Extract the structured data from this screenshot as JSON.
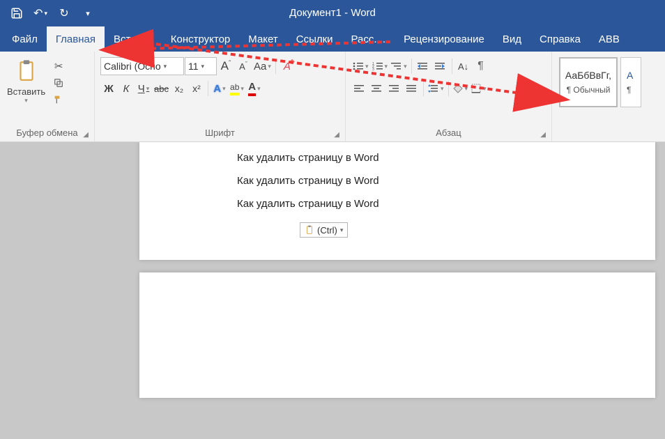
{
  "title": "Документ1  -  Word",
  "tabs": {
    "file": "Файл",
    "home": "Главная",
    "insert": "Вставка",
    "design": "Конструктор",
    "layout": "Макет",
    "references": "Ссылки",
    "mailings": "Расс....",
    "review": "Рецензирование",
    "view": "Вид",
    "help": "Справка",
    "abb": "ABB"
  },
  "clipboard": {
    "paste": "Вставить",
    "group_label": "Буфер обмена"
  },
  "font": {
    "name": "Calibri (Осно",
    "size": "11",
    "bold": "Ж",
    "italic": "К",
    "underline": "Ч",
    "strike": "abc",
    "sub": "x₂",
    "sup": "x²",
    "aa": "Aa",
    "grow": "A",
    "shrink": "A",
    "effects": "A",
    "highlight_glyph": "ab",
    "color_glyph": "A",
    "clear": "A",
    "group_label": "Шрифт"
  },
  "para": {
    "group_label": "Абзац",
    "sort": "А↓",
    "pilcrow": "¶"
  },
  "styles": {
    "preview": "АаБбВвГг,",
    "name": "¶ Обычный",
    "preview2": "А"
  },
  "doc": {
    "line1": "Как удалить страницу в Word",
    "line2": "Как удалить страницу в Word",
    "line3": "Как удалить страницу в Word",
    "paste_ctrl": "(Ctrl)"
  }
}
